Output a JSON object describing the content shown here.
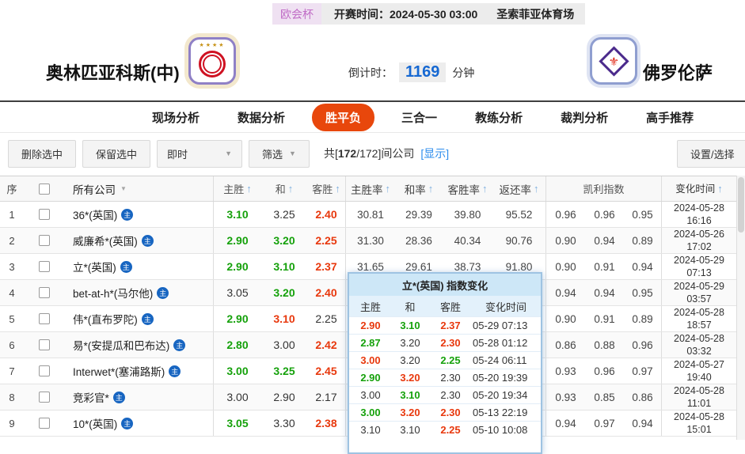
{
  "header_bar": {
    "league": "欧会杯",
    "kickoff_label": "开赛时间：",
    "kickoff_time": "2024-05-30 03:00",
    "venue": "圣索菲亚体育场"
  },
  "match": {
    "home_name": "奥林匹亚科斯(中)",
    "away_name": "佛罗伦萨",
    "countdown_label": "倒计时：",
    "countdown_value": "1169",
    "countdown_unit": "分钟",
    "home_logo_stars": "★★★★",
    "away_logo_fleur": "⚜"
  },
  "nav": {
    "tabs": [
      {
        "label": "现场分析",
        "active": false
      },
      {
        "label": "数据分析",
        "active": false
      },
      {
        "label": "胜平负",
        "active": true
      },
      {
        "label": "三合一",
        "active": false
      },
      {
        "label": "教练分析",
        "active": false
      },
      {
        "label": "裁判分析",
        "active": false
      },
      {
        "label": "高手推荐",
        "active": false
      }
    ]
  },
  "toolbar": {
    "delete_btn": "删除选中",
    "keep_btn": "保留选中",
    "instant_select": "即时",
    "filter_select": "筛选",
    "count_prefix": "共[",
    "count_current": "172",
    "count_rest": "/172]间公司",
    "show_link": "[显示]",
    "settings_btn": "设置/选择"
  },
  "table": {
    "headers": {
      "seq": "序",
      "company": "所有公司",
      "win": "主胜",
      "draw": "和",
      "lose": "客胜",
      "win_rate": "主胜率",
      "draw_rate": "和率",
      "lose_rate": "客胜率",
      "return_rate": "返还率",
      "kelly": "凯利指数",
      "change_time": "变化时间"
    },
    "badge": "主",
    "rows": [
      {
        "no": "1",
        "company": "36*(英国)",
        "odds": [
          [
            "3.10",
            "green"
          ],
          [
            "3.25",
            "black"
          ],
          [
            "2.40",
            "red"
          ]
        ],
        "rates": [
          "30.81",
          "29.39",
          "39.80",
          "95.52"
        ],
        "kelly": [
          "0.96",
          "0.96",
          "0.95"
        ],
        "date": "2024-05-28",
        "time": "16:16"
      },
      {
        "no": "2",
        "company": "威廉希*(英国)",
        "odds": [
          [
            "2.90",
            "green"
          ],
          [
            "3.20",
            "green"
          ],
          [
            "2.25",
            "red"
          ]
        ],
        "rates": [
          "31.30",
          "28.36",
          "40.34",
          "90.76"
        ],
        "kelly": [
          "0.90",
          "0.94",
          "0.89"
        ],
        "date": "2024-05-26",
        "time": "17:02"
      },
      {
        "no": "3",
        "company": "立*(英国)",
        "odds": [
          [
            "2.90",
            "green"
          ],
          [
            "3.10",
            "green"
          ],
          [
            "2.37",
            "red"
          ]
        ],
        "rates": [
          "31.65",
          "29.61",
          "38.73",
          "91.80"
        ],
        "kelly": [
          "0.90",
          "0.91",
          "0.94"
        ],
        "date": "2024-05-29",
        "time": "07:13"
      },
      {
        "no": "4",
        "company": "bet-at-h*(马尔他)",
        "odds": [
          [
            "3.05",
            "black"
          ],
          [
            "3.20",
            "green"
          ],
          [
            "2.40",
            "red"
          ]
        ],
        "rates": [
          "",
          "",
          "",
          ""
        ],
        "kelly": [
          "0.94",
          "0.94",
          "0.95"
        ],
        "date": "2024-05-29",
        "time": "03:57"
      },
      {
        "no": "5",
        "company": "伟*(直布罗陀)",
        "odds": [
          [
            "2.90",
            "green"
          ],
          [
            "3.10",
            "red"
          ],
          [
            "2.25",
            "black"
          ]
        ],
        "rates": [
          "",
          "",
          "",
          ""
        ],
        "kelly": [
          "0.90",
          "0.91",
          "0.89"
        ],
        "date": "2024-05-28",
        "time": "18:57"
      },
      {
        "no": "6",
        "company": "易*(安提瓜和巴布达)",
        "odds": [
          [
            "2.80",
            "green"
          ],
          [
            "3.00",
            "black"
          ],
          [
            "2.42",
            "red"
          ]
        ],
        "rates": [
          "",
          "",
          "",
          ""
        ],
        "kelly": [
          "0.86",
          "0.88",
          "0.96"
        ],
        "date": "2024-05-28",
        "time": "03:32"
      },
      {
        "no": "7",
        "company": "Interwet*(塞浦路斯)",
        "odds": [
          [
            "3.00",
            "green"
          ],
          [
            "3.25",
            "green"
          ],
          [
            "2.45",
            "red"
          ]
        ],
        "rates": [
          "",
          "",
          "",
          ""
        ],
        "kelly": [
          "0.93",
          "0.96",
          "0.97"
        ],
        "date": "2024-05-27",
        "time": "19:40"
      },
      {
        "no": "8",
        "company": "竞彩官*",
        "odds": [
          [
            "3.00",
            "black"
          ],
          [
            "2.90",
            "black"
          ],
          [
            "2.17",
            "black"
          ]
        ],
        "rates": [
          "",
          "",
          "",
          ""
        ],
        "kelly": [
          "0.93",
          "0.85",
          "0.86"
        ],
        "date": "2024-05-28",
        "time": "11:01"
      },
      {
        "no": "9",
        "company": "10*(英国)",
        "odds": [
          [
            "3.05",
            "green"
          ],
          [
            "3.30",
            "black"
          ],
          [
            "2.38",
            "red"
          ]
        ],
        "rates": [
          "",
          "",
          "",
          ""
        ],
        "kelly": [
          "0.94",
          "0.97",
          "0.94"
        ],
        "date": "2024-05-28",
        "time": "15:01"
      }
    ]
  },
  "popup": {
    "title": "立*(英国) 指数变化",
    "headers": {
      "win": "主胜",
      "draw": "和",
      "lose": "客胜",
      "time": "变化时间"
    },
    "rows": [
      {
        "odds": [
          [
            "2.90",
            "red"
          ],
          [
            "3.10",
            "green"
          ],
          [
            "2.37",
            "red"
          ]
        ],
        "time": "05-29 07:13"
      },
      {
        "odds": [
          [
            "2.87",
            "green"
          ],
          [
            "3.20",
            "black"
          ],
          [
            "2.30",
            "red"
          ]
        ],
        "time": "05-28 01:12"
      },
      {
        "odds": [
          [
            "3.00",
            "red"
          ],
          [
            "3.20",
            "black"
          ],
          [
            "2.25",
            "green"
          ]
        ],
        "time": "05-24 06:11"
      },
      {
        "odds": [
          [
            "2.90",
            "green"
          ],
          [
            "3.20",
            "red"
          ],
          [
            "2.30",
            "black"
          ]
        ],
        "time": "05-20 19:39"
      },
      {
        "odds": [
          [
            "3.00",
            "black"
          ],
          [
            "3.10",
            "green"
          ],
          [
            "2.30",
            "black"
          ]
        ],
        "time": "05-20 19:34"
      },
      {
        "odds": [
          [
            "3.00",
            "green"
          ],
          [
            "3.20",
            "red"
          ],
          [
            "2.30",
            "red"
          ]
        ],
        "time": "05-13 22:19"
      },
      {
        "odds": [
          [
            "3.10",
            "black"
          ],
          [
            "3.10",
            "black"
          ],
          [
            "2.25",
            "red"
          ]
        ],
        "time": "05-10 10:08"
      }
    ]
  }
}
